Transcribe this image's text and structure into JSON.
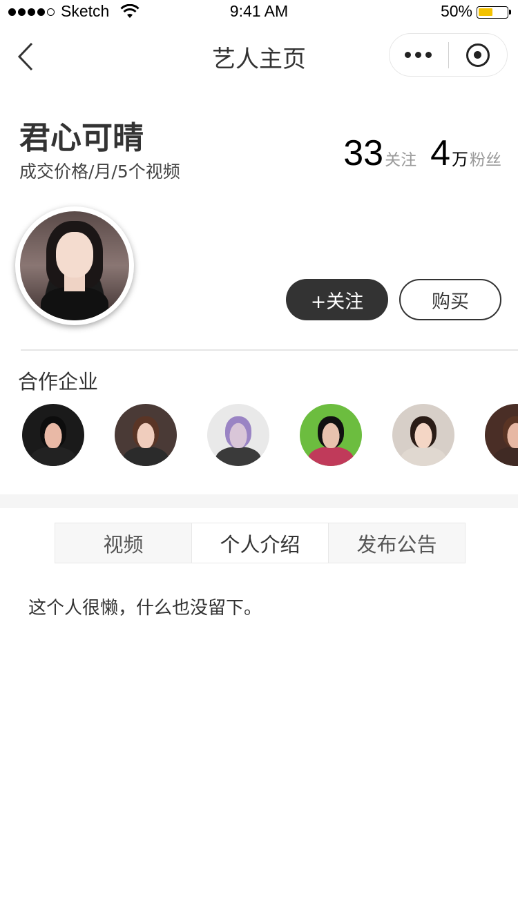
{
  "status_bar": {
    "carrier": "Sketch",
    "time": "9:41 AM",
    "battery": "50%",
    "battery_level": 0.5,
    "battery_color": "#f4c200",
    "signal_bars": 4,
    "wifi_icon": "wifi-icon"
  },
  "navbar": {
    "title": "艺人主页",
    "back_icon": "chevron-left-icon",
    "more_icon": "more-dots-icon",
    "close_icon": "target-circle-icon"
  },
  "profile": {
    "name": "君心可晴",
    "subtitle": "成交价格/月/5个视频",
    "following_count": "33",
    "following_label": "关注",
    "followers_count": "4",
    "followers_unit": "万",
    "followers_label": "粉丝",
    "follow_button": "+关注",
    "buy_button": "购买"
  },
  "partners": {
    "title": "合作企业",
    "items": [
      {
        "avatar": "partner-avatar-1",
        "bg": "#1a1a1a"
      },
      {
        "avatar": "partner-avatar-2",
        "bg": "#4a3a36"
      },
      {
        "avatar": "partner-avatar-3",
        "bg": "#e9e9e9"
      },
      {
        "avatar": "partner-avatar-4",
        "bg": "#6cbd3f"
      },
      {
        "avatar": "partner-avatar-5",
        "bg": "#d7cfc8"
      },
      {
        "avatar": "partner-avatar-6",
        "bg": "#4a2e26"
      }
    ]
  },
  "tabs": [
    {
      "label": "视频",
      "active": false
    },
    {
      "label": "个人介绍",
      "active": true
    },
    {
      "label": "发布公告",
      "active": false
    }
  ],
  "intro": {
    "text": "这个人很懒，什么也没留下。"
  },
  "colors": {
    "primary_button": "#333333",
    "muted_text": "#9a9a9a",
    "section_bg": "#f5f5f5"
  }
}
